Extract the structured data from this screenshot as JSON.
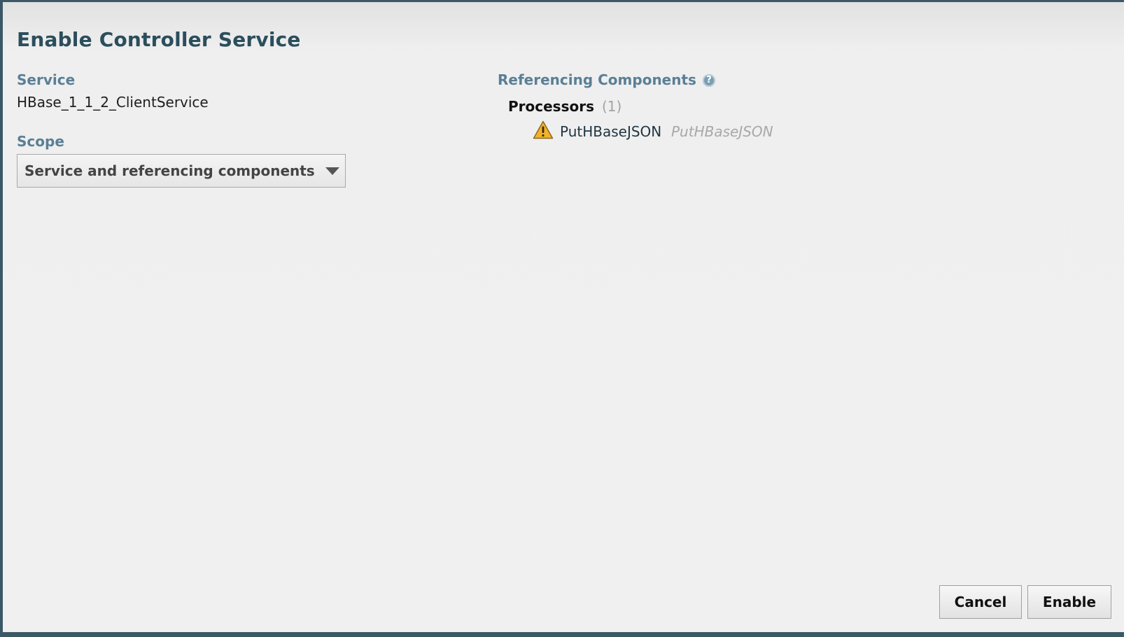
{
  "dialog": {
    "title": "Enable Controller Service"
  },
  "service": {
    "label": "Service",
    "value": "HBase_1_1_2_ClientService"
  },
  "scope": {
    "label": "Scope",
    "selected": "Service and referencing components"
  },
  "referencing": {
    "label": "Referencing Components",
    "help_icon": "?",
    "processors_label": "Processors",
    "processors_count": "(1)",
    "items": [
      {
        "name": "PutHBaseJSON",
        "type": "PutHBaseJSON",
        "status_icon": "warning-icon"
      }
    ]
  },
  "buttons": {
    "cancel": "Cancel",
    "enable": "Enable"
  },
  "colors": {
    "title": "#2b4e5c",
    "label": "#5a7f96",
    "warning": "#f2b22b"
  }
}
